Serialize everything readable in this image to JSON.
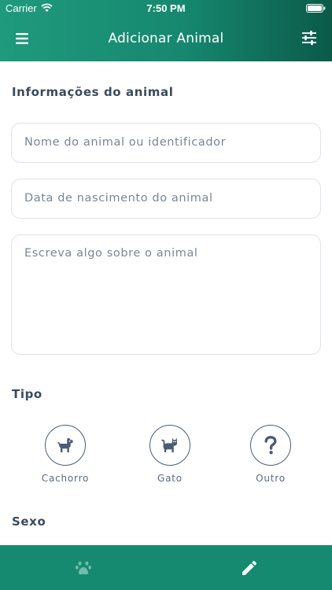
{
  "status_bar": {
    "carrier": "Carrier",
    "time": "7:50 PM"
  },
  "nav": {
    "title": "Adicionar Animal",
    "left_icon": "menu-icon",
    "right_icon": "sliders-icon"
  },
  "form": {
    "section_title": "Informações do animal",
    "name_placeholder": "Nome do animal ou identificador",
    "birth_placeholder": "Data de nascimento do animal",
    "description_placeholder": "Escreva algo sobre o animal"
  },
  "type": {
    "title": "Tipo",
    "options": [
      {
        "label": "Cachorro",
        "icon": "dog-icon"
      },
      {
        "label": "Gato",
        "icon": "cat-icon"
      },
      {
        "label": "Outro",
        "icon": "question-icon"
      }
    ]
  },
  "sex": {
    "title": "Sexo"
  },
  "tab_bar": {
    "tabs": [
      {
        "icon": "paw-icon",
        "active": false
      },
      {
        "icon": "pencil-icon",
        "active": true
      }
    ]
  },
  "colors": {
    "header_gradient_start": "#1f9a7d",
    "header_gradient_end": "#0b5a49",
    "tab_bar": "#168a70",
    "field_border": "#dfe1f0",
    "icon_dark": "#4b5c77"
  }
}
